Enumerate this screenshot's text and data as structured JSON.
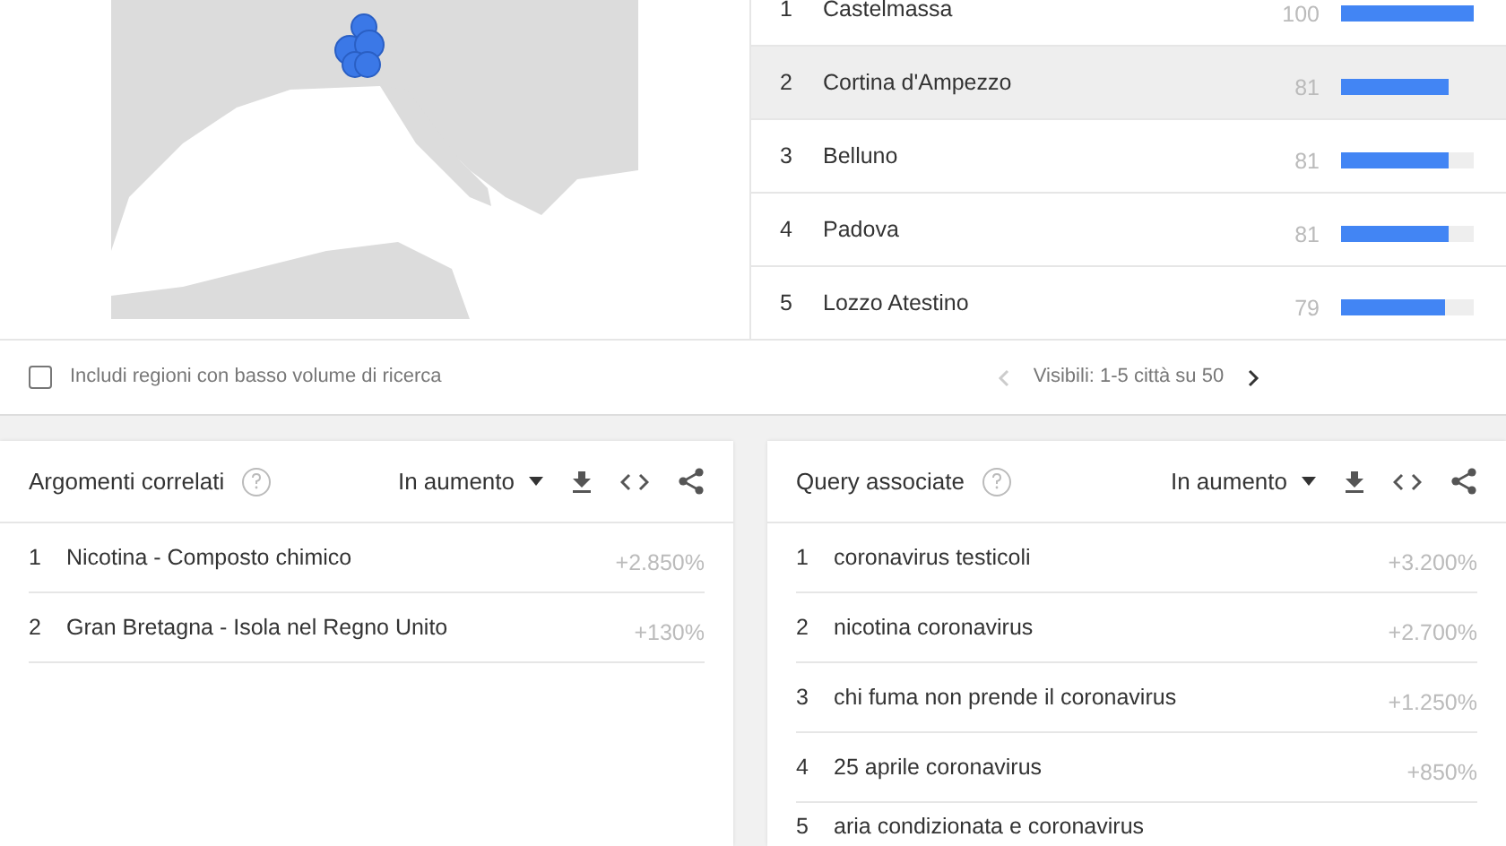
{
  "cities": {
    "rows": [
      {
        "rank": "1",
        "name": "Castelmassa",
        "value": "100",
        "level": 1.0,
        "hovered": false
      },
      {
        "rank": "2",
        "name": "Cortina d'Ampezzo",
        "value": "81",
        "level": 0.81,
        "hovered": true
      },
      {
        "rank": "3",
        "name": "Belluno",
        "value": "81",
        "level": 0.81,
        "hovered": false
      },
      {
        "rank": "4",
        "name": "Padova",
        "value": "81",
        "level": 0.81,
        "hovered": false
      },
      {
        "rank": "5",
        "name": "Lozzo Atestino",
        "value": "79",
        "level": 0.79,
        "hovered": false
      }
    ],
    "low_volume_checkbox": {
      "label": "Includi regioni con basso volume di ricerca",
      "checked": false
    },
    "pagination": {
      "label": "Visibili: 1-5 città su 50",
      "prev_disabled": true
    }
  },
  "panels": [
    {
      "title": "Argomenti correlati",
      "sort": "In aumento",
      "rows": [
        {
          "rank": "1",
          "text": "Nicotina - Composto chimico",
          "value": "+2.850%"
        },
        {
          "rank": "2",
          "text": "Gran Bretagna - Isola nel Regno Unito",
          "value": "+130%"
        }
      ]
    },
    {
      "title": "Query associate",
      "sort": "In aumento",
      "rows": [
        {
          "rank": "1",
          "text": "coronavirus testicoli",
          "value": "+3.200%"
        },
        {
          "rank": "2",
          "text": "nicotina coronavirus",
          "value": "+2.700%"
        },
        {
          "rank": "3",
          "text": "chi fuma non prende il coronavirus",
          "value": "+1.250%"
        },
        {
          "rank": "4",
          "text": "25 aprile coronavirus",
          "value": "+850%"
        },
        {
          "rank": "5",
          "text": "aria condizionata e coronavirus"
        }
      ]
    }
  ]
}
